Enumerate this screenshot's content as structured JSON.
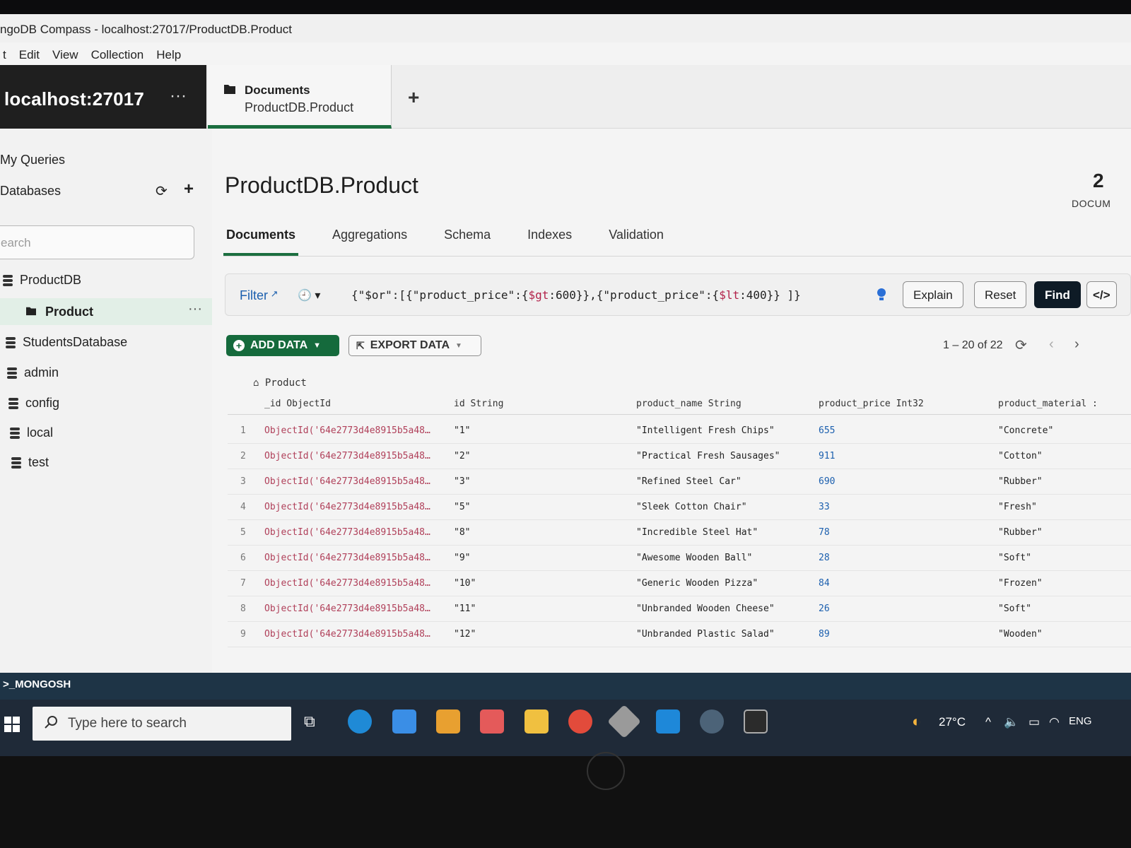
{
  "window": {
    "title": "ngoDB Compass - localhost:27017/ProductDB.Product"
  },
  "menu": [
    "t",
    "Edit",
    "View",
    "Collection",
    "Help"
  ],
  "connection": {
    "host": "localhost:27017",
    "more": "···"
  },
  "tab": {
    "title": "Documents",
    "subtitle": "ProductDB.Product",
    "new_tab": "+"
  },
  "sidebar": {
    "my_queries": "My Queries",
    "databases": "Databases",
    "search_placeholder": "earch",
    "dbs": [
      {
        "name": "ProductDB"
      },
      {
        "name": "StudentsDatabase"
      },
      {
        "name": "admin"
      },
      {
        "name": "config"
      },
      {
        "name": "local"
      },
      {
        "name": "test"
      }
    ],
    "collection": "Product",
    "collection_more": "···"
  },
  "main": {
    "title": "ProductDB.Product",
    "doc_count": "2",
    "doc_count_label": "DOCUM",
    "subtabs": [
      "Documents",
      "Aggregations",
      "Schema",
      "Indexes",
      "Validation"
    ]
  },
  "filter": {
    "label": "Filter",
    "query_prefix": "{\"$or\":[{\"product_price\":{",
    "op1": "$gt",
    "mid": ":600}},{\"product_price\":{",
    "op2": "$lt",
    "suffix": ":400}} ]}",
    "explain": "Explain",
    "reset": "Reset",
    "find": "Find"
  },
  "toolbar": {
    "add_data": "ADD DATA",
    "export_data": "EXPORT DATA",
    "pagination": "1 – 20 of 22"
  },
  "grid": {
    "breadcrumb": "Product",
    "columns": [
      "_id ObjectId",
      "id String",
      "product_name String",
      "product_price Int32",
      "product_material :"
    ],
    "rows": [
      {
        "n": "1",
        "oid": "ObjectId('64e2773d4e8915b5a48…",
        "id": "\"1\"",
        "name": "\"Intelligent Fresh Chips\"",
        "price": "655",
        "material": "\"Concrete\""
      },
      {
        "n": "2",
        "oid": "ObjectId('64e2773d4e8915b5a48…",
        "id": "\"2\"",
        "name": "\"Practical Fresh Sausages\"",
        "price": "911",
        "material": "\"Cotton\""
      },
      {
        "n": "3",
        "oid": "ObjectId('64e2773d4e8915b5a48…",
        "id": "\"3\"",
        "name": "\"Refined Steel Car\"",
        "price": "690",
        "material": "\"Rubber\""
      },
      {
        "n": "4",
        "oid": "ObjectId('64e2773d4e8915b5a48…",
        "id": "\"5\"",
        "name": "\"Sleek Cotton Chair\"",
        "price": "33",
        "material": "\"Fresh\""
      },
      {
        "n": "5",
        "oid": "ObjectId('64e2773d4e8915b5a48…",
        "id": "\"8\"",
        "name": "\"Incredible Steel Hat\"",
        "price": "78",
        "material": "\"Rubber\""
      },
      {
        "n": "6",
        "oid": "ObjectId('64e2773d4e8915b5a48…",
        "id": "\"9\"",
        "name": "\"Awesome Wooden Ball\"",
        "price": "28",
        "material": "\"Soft\""
      },
      {
        "n": "7",
        "oid": "ObjectId('64e2773d4e8915b5a48…",
        "id": "\"10\"",
        "name": "\"Generic Wooden Pizza\"",
        "price": "84",
        "material": "\"Frozen\""
      },
      {
        "n": "8",
        "oid": "ObjectId('64e2773d4e8915b5a48…",
        "id": "\"11\"",
        "name": "\"Unbranded Wooden Cheese\"",
        "price": "26",
        "material": "\"Soft\""
      },
      {
        "n": "9",
        "oid": "ObjectId('64e2773d4e8915b5a48…",
        "id": "\"12\"",
        "name": "\"Unbranded Plastic Salad\"",
        "price": "89",
        "material": "\"Wooden\""
      }
    ]
  },
  "mongosh": ">_MONGOSH",
  "taskbar": {
    "search_placeholder": "Type here to search",
    "weather": "27°C",
    "lang": "ENG"
  },
  "colors": {
    "accent": "#1b6e3f",
    "find_button": "#0e1b26",
    "link": "#1b5fae",
    "oid": "#b0405a"
  }
}
